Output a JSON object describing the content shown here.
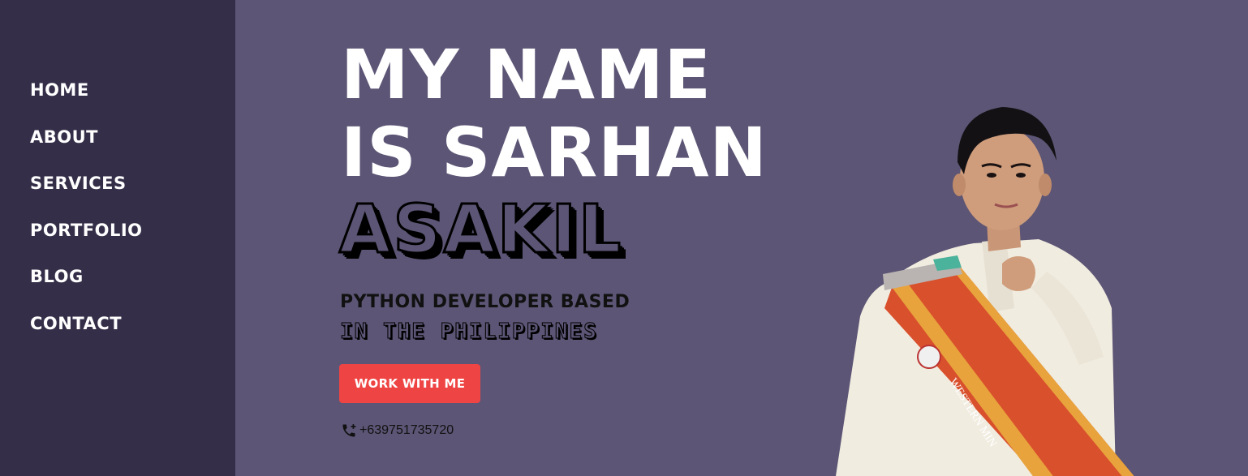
{
  "sidebar": {
    "items": [
      {
        "label": "HOME"
      },
      {
        "label": "ABOUT"
      },
      {
        "label": "SERVICES"
      },
      {
        "label": "PORTFOLIO"
      },
      {
        "label": "BLOG"
      },
      {
        "label": "CONTACT"
      }
    ]
  },
  "hero": {
    "headline_line1": "MY NAME",
    "headline_line2": "IS SARHAN",
    "surname": "ASAKIL",
    "tagline_line1": "PYTHON DEVELOPER BASED",
    "tagline_line2": "IN THE PHILIPPINES",
    "cta_label": "WORK WITH ME",
    "phone": "+639751735720",
    "sash_text": "WESTERN MIN"
  },
  "colors": {
    "sidebar_bg": "#342e48",
    "main_bg": "#5c5575",
    "accent": "#ef4444",
    "text_light": "#ffffff",
    "text_dark": "#111111"
  },
  "icons": {
    "phone": "phone-plus-icon"
  }
}
